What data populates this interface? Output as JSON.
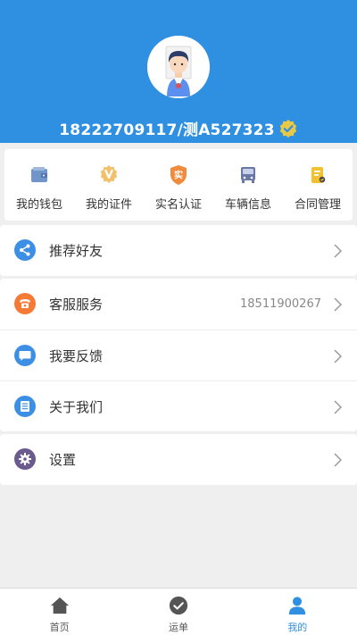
{
  "header": {
    "user_title": "18222709117/测A527323"
  },
  "quick_menu": [
    {
      "label": "我的钱包",
      "icon": "wallet-icon",
      "color": "#6f95c9"
    },
    {
      "label": "我的证件",
      "icon": "certificate-icon",
      "color": "#f1c26b"
    },
    {
      "label": "实名认证",
      "icon": "real-name-icon",
      "color": "#f08a3c"
    },
    {
      "label": "车辆信息",
      "icon": "truck-icon",
      "color": "#6a78a6"
    },
    {
      "label": "合同管理",
      "icon": "contract-icon",
      "color": "#f1c12f"
    }
  ],
  "menu": {
    "recommend": {
      "label": "推荐好友",
      "icon": "share-icon",
      "color": "#3d8fe6"
    },
    "service": {
      "label": "客服服务",
      "value": "18511900267",
      "icon": "phone-icon",
      "color": "#f47a35"
    },
    "feedback": {
      "label": "我要反馈",
      "icon": "chat-icon",
      "color": "#3d8fe6"
    },
    "about": {
      "label": "关于我们",
      "icon": "document-icon",
      "color": "#3d8fe6"
    },
    "settings": {
      "label": "设置",
      "icon": "gear-icon",
      "color": "#6a5a8e"
    }
  },
  "tabs": [
    {
      "label": "首页",
      "icon": "home-icon"
    },
    {
      "label": "运单",
      "icon": "check-icon"
    },
    {
      "label": "我的",
      "icon": "user-icon",
      "active": true
    }
  ],
  "colors": {
    "primary": "#2f8fe1",
    "background": "#efefef"
  }
}
